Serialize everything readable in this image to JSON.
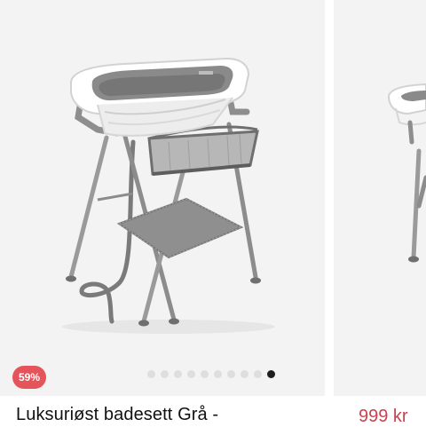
{
  "products": [
    {
      "discount_badge": "59%",
      "title": "Luksuriøst badesett Grå -",
      "image": "baby-bath-stand-with-storage-basket",
      "gallery": {
        "total": 10,
        "active_index": 9
      }
    },
    {
      "price": "999 kr",
      "image": "baby-bath-stand"
    }
  ],
  "colors": {
    "badge_bg": "#e4545a",
    "price_text": "#c9424f",
    "card_bg": "#f3f3f3",
    "dot_active": "#1e1e1e",
    "dot_inactive": "#dedede"
  }
}
